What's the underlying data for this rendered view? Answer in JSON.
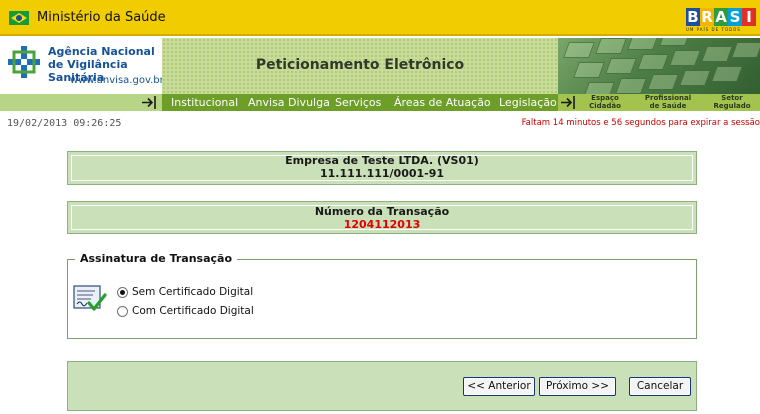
{
  "gov_bar": {
    "ministry": "Ministério da Saúde",
    "brasil_logo": "BRASIL",
    "brasil_tagline": "UM PAÍS DE TODOS"
  },
  "agency": {
    "name_line1": "Agência Nacional",
    "name_line2": "de Vigilância Sanitária",
    "url": "www.anvisa.gov.br"
  },
  "header": {
    "title": "Peticionamento Eletrônico"
  },
  "nav": {
    "items": [
      "Institucional",
      "Anvisa Divulga",
      "Serviços",
      "Áreas de Atuação",
      "Legislação"
    ],
    "profiles": [
      "Espaço\nCidadão",
      "Profissional\nde Saúde",
      "Setor\nRegulado"
    ]
  },
  "session": {
    "timestamp": "19/02/2013 09:26:25",
    "expiry": "Faltam 14 minutos e 56 segundos para expirar a sessão"
  },
  "company": {
    "name": "Empresa de Teste LTDA. (VS01)",
    "cnpj": "11.111.111/0001-91"
  },
  "transaction": {
    "label": "Número da Transação",
    "number": "1204112013"
  },
  "signature": {
    "legend": "Assinatura de Transação",
    "options": [
      {
        "label": "Sem Certificado Digital",
        "selected": true
      },
      {
        "label": "Com Certificado Digital",
        "selected": false
      }
    ],
    "icon": "signed-document-icon"
  },
  "buttons": {
    "previous": "<< Anterior",
    "next": "Próximo >>",
    "cancel": "Cancelar"
  },
  "colors": {
    "gov_yellow": "#f1cc00",
    "nav_green": "#6c9e28",
    "panel_green": "#c9e0b9",
    "alert_red": "#cc0000"
  }
}
